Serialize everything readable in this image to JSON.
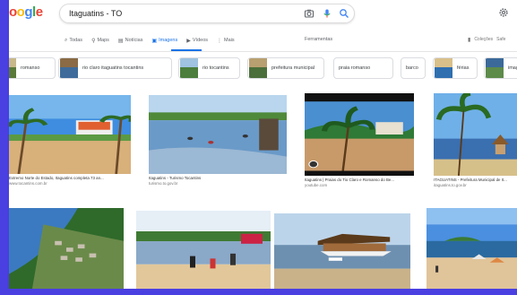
{
  "header": {
    "logo_letters": [
      "o",
      "o",
      "g",
      "l",
      "e"
    ],
    "logo_colors": [
      "#ea4335",
      "#fbbc05",
      "#4285f4",
      "#34a853",
      "#ea4335"
    ],
    "search_value": "Itaguatins - TO"
  },
  "tabs": [
    {
      "icon": "search-icon",
      "glyph": "⌕",
      "label": "Todas"
    },
    {
      "icon": "map-pin-icon",
      "glyph": "⚲",
      "label": "Maps"
    },
    {
      "icon": "news-icon",
      "glyph": "▤",
      "label": "Notícias"
    },
    {
      "icon": "image-icon",
      "glyph": "▣",
      "label": "Imagens",
      "active": true
    },
    {
      "icon": "video-icon",
      "glyph": "▶",
      "label": "Vídeos"
    },
    {
      "icon": "more-icon",
      "glyph": "⋮",
      "label": "Mais"
    }
  ],
  "tools_label": "Ferramentas",
  "right_tools": [
    "Coleções",
    "Safe"
  ],
  "chips": [
    {
      "label": "romanso",
      "thumb": true
    },
    {
      "label": "rio claro itaguatins tocantins",
      "thumb": true
    },
    {
      "label": "rio tocantins",
      "thumb": true
    },
    {
      "label": "prefeitura municipal",
      "thumb": true
    },
    {
      "label": "praia romanso",
      "thumb": false
    },
    {
      "label": "barco",
      "thumb": false
    },
    {
      "label": "férias",
      "thumb": true
    },
    {
      "label": "imagens",
      "thumb": true
    }
  ],
  "results": [
    {
      "title": "Extremo Norte do Estado, Itaguatins completa 73 an...",
      "source": "www.tocantins.com.br"
    },
    {
      "title": "Itaguatins - Turismo Tocantins",
      "source": "turismo.to.gov.br"
    },
    {
      "title": "Itaguatins | Praias do Tio Claro e Romanso do Be...",
      "source": "youtube.com"
    },
    {
      "title": "ITAGUATINS - Prefeitura Municipal de It...",
      "source": "itaguatins.to.gov.br"
    },
    {
      "title": "",
      "source": ""
    },
    {
      "title": "",
      "source": ""
    },
    {
      "title": "",
      "source": ""
    },
    {
      "title": "",
      "source": ""
    }
  ]
}
